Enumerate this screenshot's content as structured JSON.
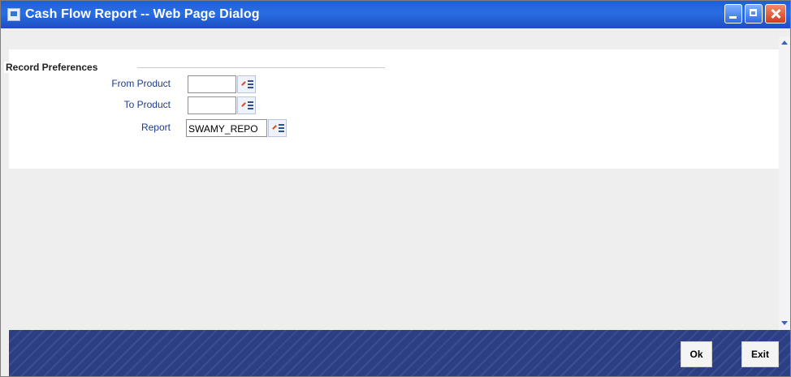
{
  "window": {
    "title": "Cash Flow Report -- Web Page Dialog"
  },
  "section": {
    "legend": "Record Preferences"
  },
  "fields": {
    "from_product": {
      "label": "From Product",
      "value": ""
    },
    "to_product": {
      "label": "To Product",
      "value": ""
    },
    "report": {
      "label": "Report",
      "value": "SWAMY_REPO"
    }
  },
  "icons": {
    "lov": "list-of-values-icon",
    "minimize": "minimize-icon",
    "maximize": "maximize-icon",
    "close": "close-icon"
  },
  "buttons": {
    "ok": "Ok",
    "exit": "Exit"
  },
  "colors": {
    "titlebar": "#1f5fd3",
    "footer": "#2c3f85",
    "label_text": "#1e3b8f"
  }
}
